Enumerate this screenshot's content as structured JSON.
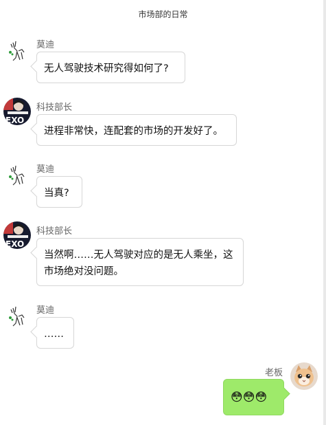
{
  "header": {
    "title": "市场部的日常"
  },
  "messages": [
    {
      "sender": "莫迪",
      "text": "无人驾驶技术研究得如何了?"
    },
    {
      "sender": "科技部长",
      "text": "进程非常快，连配套的市场的开发好了。"
    },
    {
      "sender": "莫迪",
      "text": "当真?"
    },
    {
      "sender": "科技部长",
      "text": "当然啊……无人驾驶对应的是无人乘坐，这市场绝对没问题。"
    },
    {
      "sender": "莫迪",
      "text": "……"
    },
    {
      "sender": "老板",
      "text": "😳😳😳"
    }
  ],
  "avatars": {
    "modi": "deer-sketch-avatar",
    "tech_minister": "exo-poster-avatar",
    "boss": "cat-avatar"
  },
  "colors": {
    "self_bubble": "#9eea6a",
    "other_bubble": "#ffffff",
    "bubble_border": "#d6d6d6"
  }
}
